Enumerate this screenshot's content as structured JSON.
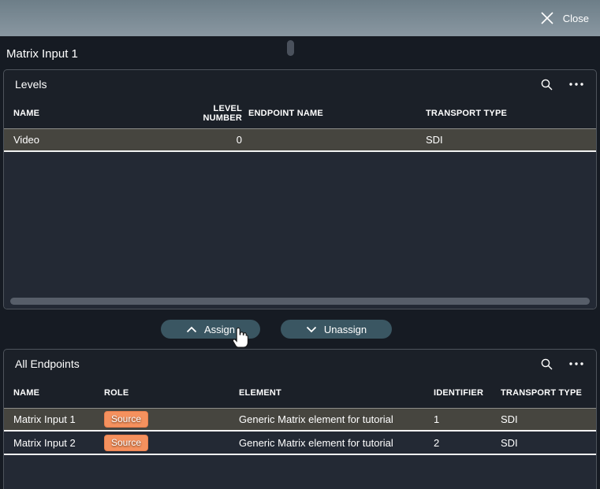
{
  "topbar": {
    "close_label": "Close"
  },
  "page": {
    "title": "Matrix Input 1"
  },
  "levels_panel": {
    "title": "Levels",
    "columns": [
      "NAME",
      "LEVEL NUMBER",
      "ENDPOINT NAME",
      "TRANSPORT TYPE"
    ],
    "rows": [
      {
        "name": "Video",
        "level_number": "0",
        "endpoint_name": "",
        "transport_type": "SDI",
        "selected": true
      }
    ]
  },
  "actions": {
    "assign_label": "Assign",
    "unassign_label": "Unassign"
  },
  "endpoints_panel": {
    "title": "All Endpoints",
    "columns": [
      "NAME",
      "ROLE",
      "ELEMENT",
      "IDENTIFIER",
      "TRANSPORT TYPE"
    ],
    "rows": [
      {
        "name": "Matrix Input 1",
        "role": "Source",
        "element": "Generic Matrix element for tutorial",
        "identifier": "1",
        "transport_type": "SDI",
        "selected": true
      },
      {
        "name": "Matrix Input 2",
        "role": "Source",
        "element": "Generic Matrix element for tutorial",
        "identifier": "2",
        "transport_type": "SDI",
        "selected": false
      }
    ]
  },
  "colors": {
    "topbar_gradient_top": "#6d7e88",
    "topbar_gradient_bottom": "#8997a1",
    "page_background": "#161b23",
    "panel_header_background": "#1b2028",
    "table_body_background": "#232934",
    "selected_row_background": "#46453f",
    "button_teal": "#3a5662",
    "badge_orange": "#f5915e"
  },
  "icons": {
    "close": "close-icon",
    "search": "search-icon",
    "ellipsis": "ellipsis-icon",
    "chevron_up": "chevron-up-icon",
    "chevron_down": "chevron-down-icon",
    "cursor": "hand-pointer-icon"
  }
}
